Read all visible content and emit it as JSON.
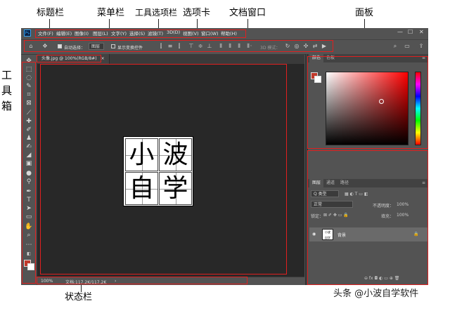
{
  "annotations": {
    "title_bar": "标题栏",
    "menu_bar": "菜单栏",
    "options_bar": "工具选项栏",
    "tab": "选项卡",
    "doc_window": "文档窗口",
    "panel": "面板",
    "toolbox": [
      "工",
      "具",
      "箱"
    ],
    "status_bar": "状态栏"
  },
  "app": {
    "logo": "Ps",
    "menu_items": [
      "文件(F)",
      "编辑(E)",
      "图像(I)",
      "图层(L)",
      "文字(Y)",
      "选择(S)",
      "滤镜(T)",
      "3D(D)",
      "视图(V)",
      "窗口(W)",
      "帮助(H)"
    ],
    "window_controls": [
      "—",
      "☐",
      "✕"
    ]
  },
  "options_bar": {
    "auto_select_label": "自动选择：",
    "auto_select_value": "图层",
    "show_transform_label": "显示变换控件",
    "mode_3d_label": "3D 模式："
  },
  "document": {
    "tab_label": "头像.jpg @ 100%(RGB/8#)",
    "tab_close": "×",
    "characters": [
      "小",
      "波",
      "自",
      "学"
    ]
  },
  "status": {
    "zoom": "100%",
    "doc_info": "文档:117.2K/117.2K"
  },
  "panels": {
    "color_tabs": [
      "颜色",
      "色板"
    ],
    "layers_tabs": [
      "图层",
      "通道",
      "路径"
    ],
    "kind_filter": "Q 类型",
    "blend_mode": "正常",
    "opacity_label": "不透明度：",
    "opacity_value": "100%",
    "lock_label": "锁定：",
    "fill_label": "填充：",
    "fill_value": "100%",
    "layer_name": "背景",
    "bottom_icons": "⊖  fx  ◘  ◐  ▭  ⊕  🗑"
  },
  "colors": {
    "foreground": "#c0392b",
    "background": "#ffffff",
    "annotation_red": "#e02020"
  },
  "watermark": "头条 @小波自学软件"
}
